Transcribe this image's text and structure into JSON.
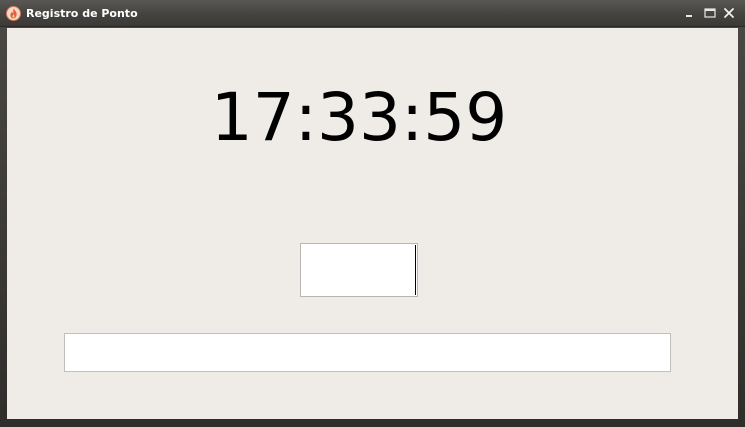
{
  "window": {
    "title": "Registro de Ponto",
    "icon": "flame-icon",
    "controls": [
      "minimize-icon",
      "maximize-icon",
      "close-icon"
    ]
  },
  "clock": {
    "time": "17:33:59"
  },
  "code_input": {
    "value": ""
  },
  "message_field": {
    "value": ""
  },
  "colors": {
    "client_background": "#efebe7",
    "titlebar": "#44433f",
    "icon_accent": "#e0603a"
  }
}
